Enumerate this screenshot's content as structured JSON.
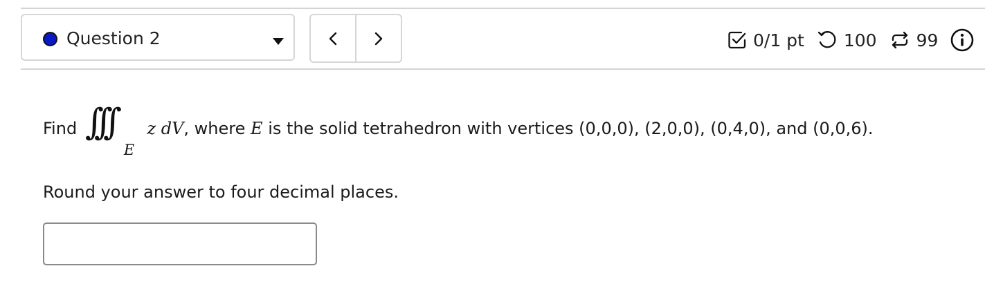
{
  "header": {
    "question_selector": {
      "label": "Question 2",
      "status_color": "#0a18c8"
    },
    "nav": {
      "prev_icon": "chevron-left-icon",
      "next_icon": "chevron-right-icon"
    },
    "score": {
      "points": "0/1 pt",
      "retries": "100",
      "attempts": "99"
    }
  },
  "question": {
    "find": "Find",
    "integral_sign": "∫∫∫",
    "region_sub": "E",
    "integrand": "z dV",
    "sentence_rest": ", where ",
    "region_name": "E",
    "sentence_tail": " is the solid tetrahedron with vertices (0,0,0), (2,0,0), (0,4,0), and (0,0,6).",
    "instruction": "Round your answer to four decimal places."
  },
  "answer": {
    "value": ""
  }
}
